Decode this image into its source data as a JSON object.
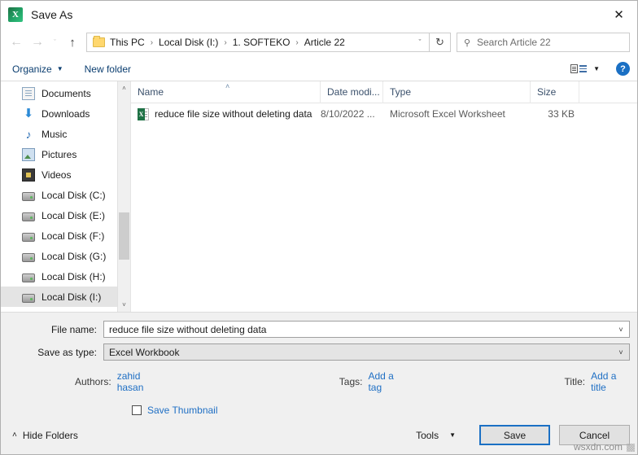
{
  "window": {
    "title": "Save As",
    "app_icon": "excel-icon",
    "close_label": "✕"
  },
  "nav": {
    "back": "←",
    "forward": "→",
    "recent": "ˇ",
    "up": "↑",
    "refresh": "↻",
    "dropdown": "ˇ",
    "breadcrumbs": [
      "This PC",
      "Local Disk (I:)",
      "1. SOFTEKO",
      "Article 22"
    ],
    "separator": "›"
  },
  "search": {
    "placeholder": "Search Article 22",
    "icon": "search-icon"
  },
  "toolbar": {
    "organize": "Organize",
    "organize_caret": "▼",
    "new_folder": "New folder",
    "view_caret": "▼",
    "help": "?"
  },
  "sidebar": {
    "items": [
      {
        "label": "Documents",
        "icon": "documents-icon",
        "selected": false
      },
      {
        "label": "Downloads",
        "icon": "downloads-icon",
        "selected": false
      },
      {
        "label": "Music",
        "icon": "music-icon",
        "selected": false
      },
      {
        "label": "Pictures",
        "icon": "pictures-icon",
        "selected": false
      },
      {
        "label": "Videos",
        "icon": "videos-icon",
        "selected": false
      },
      {
        "label": "Local Disk (C:)",
        "icon": "drive-icon",
        "selected": false
      },
      {
        "label": "Local Disk (E:)",
        "icon": "drive-icon",
        "selected": false
      },
      {
        "label": "Local Disk (F:)",
        "icon": "drive-icon",
        "selected": false
      },
      {
        "label": "Local Disk (G:)",
        "icon": "drive-icon",
        "selected": false
      },
      {
        "label": "Local Disk (H:)",
        "icon": "drive-icon",
        "selected": false
      },
      {
        "label": "Local Disk (I:)",
        "icon": "drive-icon",
        "selected": true
      }
    ],
    "scroll_up": "˄",
    "scroll_down": "˅"
  },
  "filelist": {
    "columns": [
      "Name",
      "Date modi...",
      "Type",
      "Size"
    ],
    "sort_indicator": "˄",
    "rows": [
      {
        "name": "reduce file size without deleting data",
        "date": "8/10/2022 ...",
        "type": "Microsoft Excel Worksheet",
        "size": "33 KB",
        "icon": "excel-file-icon"
      }
    ]
  },
  "form": {
    "file_name_label": "File name:",
    "file_name_value": "reduce file size without deleting data",
    "save_type_label": "Save as type:",
    "save_type_value": "Excel Workbook",
    "combo_caret": "˅",
    "authors_label": "Authors:",
    "authors_value": "zahid hasan",
    "tags_label": "Tags:",
    "tags_value": "Add a tag",
    "title_label": "Title:",
    "title_value": "Add a title",
    "save_thumbnail_label": "Save Thumbnail",
    "save_thumbnail_checked": false
  },
  "footer": {
    "hide_folders": "Hide Folders",
    "hide_folders_caret": "˄",
    "tools": "Tools",
    "tools_caret": "▼",
    "save": "Save",
    "cancel": "Cancel",
    "watermark": "wsxdn.com"
  },
  "colors": {
    "accent": "#1b70c4",
    "link": "#1f6fc4",
    "excel_green": "#1e7145",
    "selection": "#e4e4e4",
    "chrome": "#f0f0f0"
  }
}
